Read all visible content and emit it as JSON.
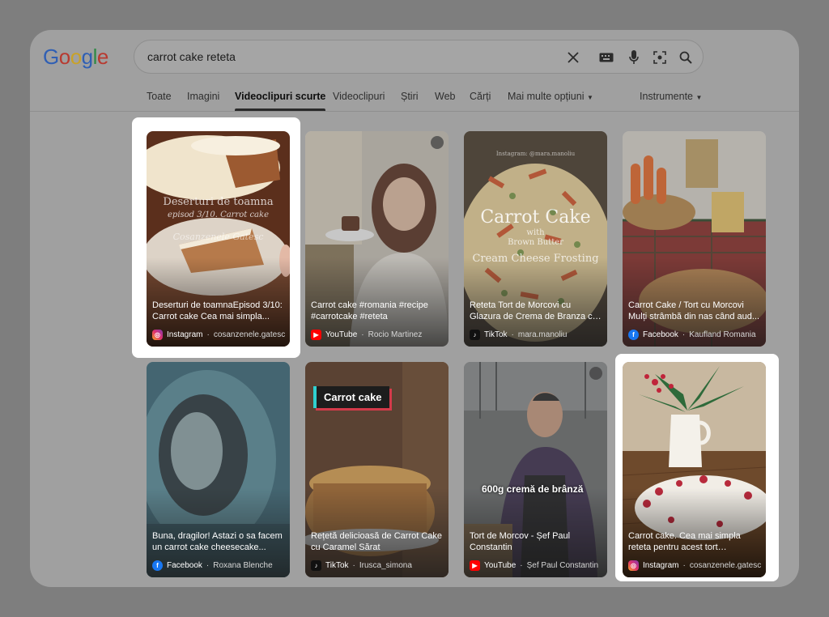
{
  "logo": "Google",
  "search": {
    "query": "carrot cake reteta"
  },
  "tabs": [
    {
      "label": "Toate"
    },
    {
      "label": "Imagini"
    },
    {
      "label": "Videoclipuri scurte"
    },
    {
      "label": "Videoclipuri"
    },
    {
      "label": "Știri"
    },
    {
      "label": "Web"
    },
    {
      "label": "Cărți"
    },
    {
      "label": "Mai multe opțiuni"
    }
  ],
  "tools_label": "Instrumente",
  "videos": [
    {
      "caption": "Deserturi de toamnaEpisod 3/10: Carrot cake Cea mai simpla...",
      "platform": "Instagram",
      "channel": "cosanzenele.gatesc",
      "overlay_text": "Deserturi de toamna",
      "overlay_sub": "episod 3/10. Carrot cake",
      "overlay_sign": "Cosanzenele Gatesc"
    },
    {
      "caption": "Carrot cake  #romania #recipe #carrotcake #reteta",
      "platform": "YouTube",
      "channel": "Rocio Martinez"
    },
    {
      "caption": "Reteta Tort de Morcovi cu Glazura de Crema de Branza cu Carrot...",
      "platform": "TikTok",
      "channel": "mara.manoliu",
      "overlay_top": "Instagram: @mara.manoliu",
      "overlay_title": "Carrot Cake",
      "overlay_with": "with",
      "overlay_sub": "Brown Butter",
      "overlay_sub2": "Cream Cheese Frosting"
    },
    {
      "caption": "Carrot Cake / Tort cu Morcovi Mulți strâmbă din nas când aud...",
      "platform": "Facebook",
      "channel": "Kaufland Romania"
    },
    {
      "caption": "Buna, dragilor! Astazi o sa facem un carrot cake cheesecake...",
      "platform": "Facebook",
      "channel": "Roxana Blenche"
    },
    {
      "caption": "Rețetă delicioasă de Carrot Cake cu Caramel Sărat",
      "platform": "TikTok",
      "channel": "Irusca_simona",
      "overlay_tag": "Carrot cake"
    },
    {
      "caption": "Tort de Morcov - Șef Paul Constantin",
      "platform": "YouTube",
      "channel": "Șef Paul Constantin",
      "overlay_tag": "600g cremă de brânză"
    },
    {
      "caption": "Carrot cake. Cea mai simpla reteta pentru acest tort incredibil...",
      "platform": "Instagram",
      "channel": "cosanzenele.gatesc"
    }
  ],
  "colors": {
    "page_bg": "#7e7e7e",
    "window_bg": "#a0a0a0",
    "highlight": "#ffffff"
  }
}
